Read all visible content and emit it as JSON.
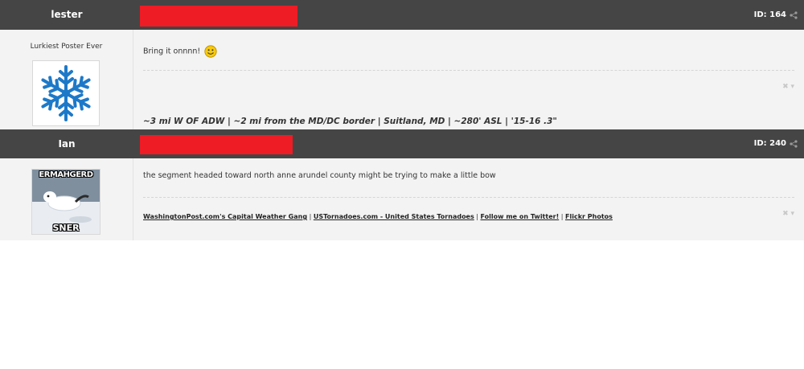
{
  "posts": [
    {
      "author": "lester",
      "post_id": "ID: 164",
      "rank": "Lurkiest Poster Ever",
      "avatar_icon": "snowflake-icon",
      "message": "Bring it onnnn!",
      "emoji": "smiley-icon",
      "signature": "~3 mi W OF ADW | ~2 mi from the MD/DC border | Suitland, MD | ~280' ASL | '15-16 .3\""
    },
    {
      "author": "Ian",
      "post_id": "ID: 240",
      "avatar_caption_top": "ERMAHGERD",
      "avatar_caption_bottom": "SNER",
      "message": "the segment headed toward north anne arundel county might be trying to make a little bow",
      "signature_links": [
        "WashingtonPost.com's Capital Weather Gang",
        "USTornadoes.com - United States Tornadoes",
        "Follow me on Twitter!",
        "Flickr Photos"
      ],
      "signature_separator": " | "
    }
  ],
  "colors": {
    "header_bg": "#454545",
    "redaction": "#ee1c25",
    "body_bg": "#f3f3f3"
  }
}
